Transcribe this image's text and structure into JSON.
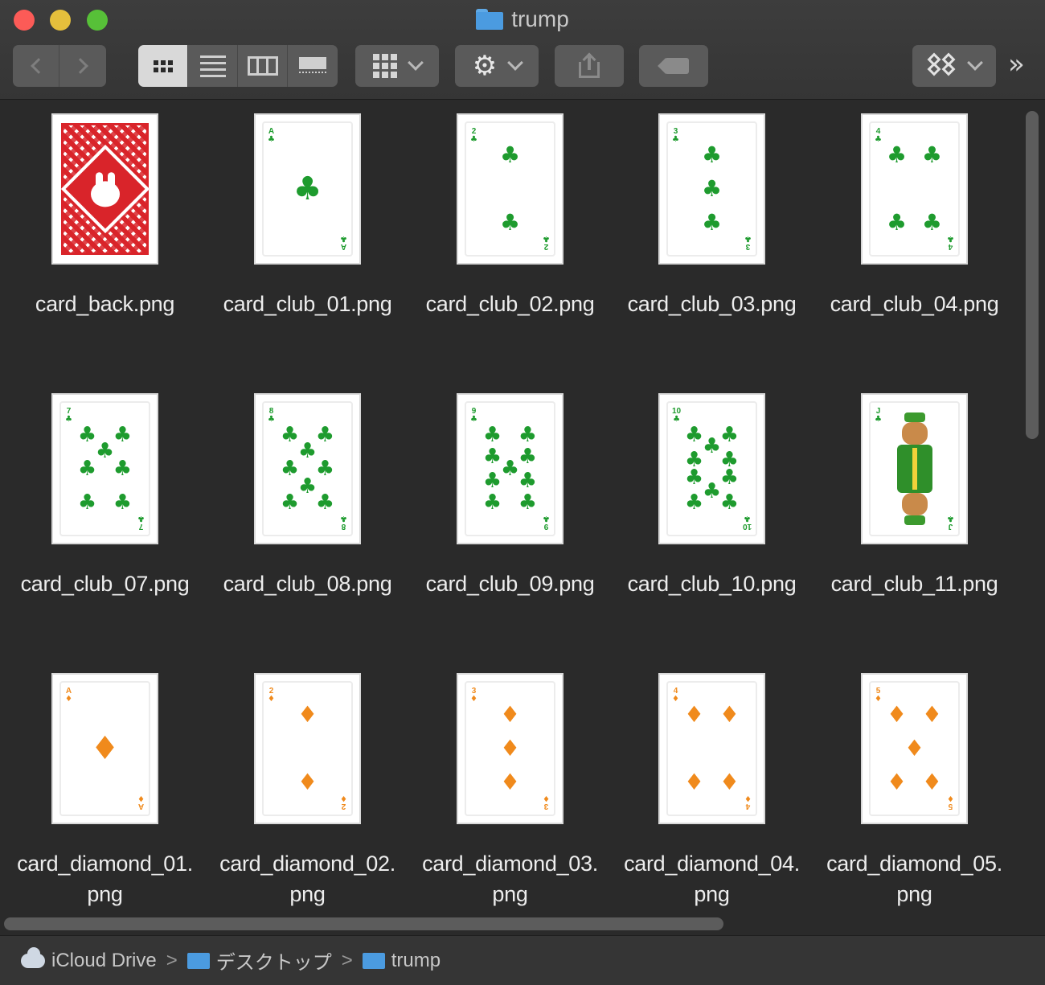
{
  "window": {
    "title": "trump"
  },
  "toolbar": {
    "back_icon": "chevron-left-icon",
    "forward_icon": "chevron-right-icon",
    "view_modes": [
      "icon-view",
      "list-view",
      "column-view",
      "gallery-view"
    ],
    "active_view": "icon-view",
    "group_icon": "grid-icon",
    "action_icon": "gear-icon",
    "share_icon": "share-icon",
    "tag_icon": "tag-icon",
    "dropbox_icon": "dropbox-icon",
    "overflow_label": "»"
  },
  "files": [
    {
      "name": "card_back.png",
      "kind": "back"
    },
    {
      "name": "card_club_01.png",
      "kind": "club",
      "rank": "A",
      "count": 1
    },
    {
      "name": "card_club_02.png",
      "kind": "club",
      "rank": "2",
      "count": 2
    },
    {
      "name": "card_club_03.png",
      "kind": "club",
      "rank": "3",
      "count": 3
    },
    {
      "name": "card_club_04.png",
      "kind": "club",
      "rank": "4",
      "count": 4
    },
    {
      "name": "card_club_07.png",
      "kind": "club",
      "rank": "7",
      "count": 7
    },
    {
      "name": "card_club_08.png",
      "kind": "club",
      "rank": "8",
      "count": 8
    },
    {
      "name": "card_club_09.png",
      "kind": "club",
      "rank": "9",
      "count": 9
    },
    {
      "name": "card_club_10.png",
      "kind": "club",
      "rank": "10",
      "count": 10
    },
    {
      "name": "card_club_11.png",
      "kind": "jack",
      "rank": "J"
    },
    {
      "name": "card_diamond_01.\npng",
      "kind": "diamond",
      "rank": "A",
      "count": 1
    },
    {
      "name": "card_diamond_02.\npng",
      "kind": "diamond",
      "rank": "2",
      "count": 2
    },
    {
      "name": "card_diamond_03.\npng",
      "kind": "diamond",
      "rank": "3",
      "count": 3
    },
    {
      "name": "card_diamond_04.\npng",
      "kind": "diamond",
      "rank": "4",
      "count": 4
    },
    {
      "name": "card_diamond_05.\npng",
      "kind": "diamond",
      "rank": "5",
      "count": 5
    }
  ],
  "pathbar": {
    "items": [
      {
        "label": "iCloud Drive",
        "icon": "cloud-icon"
      },
      {
        "label": "デスクトップ",
        "icon": "folder-icon"
      },
      {
        "label": "trump",
        "icon": "folder-icon"
      }
    ],
    "separator": ">"
  },
  "colors": {
    "club": "#1e9b2e",
    "diamond": "#f08a1c",
    "back": "#d9242a",
    "folder": "#4b9be0"
  }
}
